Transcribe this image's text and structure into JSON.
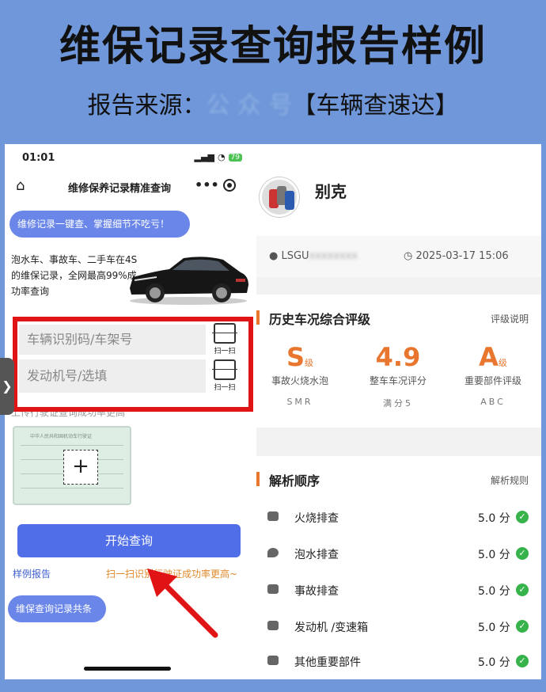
{
  "hero": {
    "title": "维保记录查询报告样例",
    "source_prefix": "报告来源：",
    "source_blurred": "公 众 号",
    "source_suffix": "【车辆查速达】"
  },
  "phone": {
    "time": "01:01",
    "battery": "79",
    "nav_title": "维修保养记录精准查询",
    "nav_more": "•••",
    "promo": "维修记录一键查、掌握细节不吃亏！",
    "intro": "泡水车、事故车、二手车在4S的维保记录，全网最高99%成功率查询",
    "vin_placeholder": "车辆识别码/车架号",
    "engine_placeholder": "发动机号/选填",
    "scan_label": "扫一扫",
    "upload_hint": "上传行驶证查询成功率更高",
    "license_title": "中华人民共和国机动车行驶证",
    "plus": "+",
    "side_handle": "❯",
    "start_button": "开始查询",
    "sample_link": "样例报告",
    "scan_tip": "扫一扫识别行驶证成功率更高~",
    "history_pill": "维保查询记录共条"
  },
  "report": {
    "brand": "别克",
    "vin_prefix": "LSGU",
    "vin_masked": "xxxxxxxx",
    "timestamp": "2025-03-17 15:06",
    "rating_card": {
      "title": "历史车况综合评级",
      "link": "评级说明",
      "grades": [
        {
          "value": "S",
          "unit": "级",
          "label": "事故火烧水泡",
          "sub": "SMR"
        },
        {
          "value": "4.9",
          "unit": "",
          "label": "整车车况评分",
          "sub": "满分5"
        },
        {
          "value": "A",
          "unit": "级",
          "label": "重要部件评级",
          "sub": "ABC"
        }
      ]
    },
    "analysis_card": {
      "title": "解析顺序",
      "link": "解析规则",
      "rows": [
        {
          "name": "火烧排查",
          "score": "5.0 分"
        },
        {
          "name": "泡水排查",
          "score": "5.0 分"
        },
        {
          "name": "事故排查",
          "score": "5.0 分"
        },
        {
          "name": "发动机 /变速箱",
          "score": "5.0 分"
        },
        {
          "name": "其他重要部件",
          "score": "5.0 分"
        }
      ]
    }
  },
  "colors": {
    "accent": "#e8762e",
    "primary": "#4f6ee8",
    "alert": "#e01414",
    "ok": "#36b34a"
  }
}
